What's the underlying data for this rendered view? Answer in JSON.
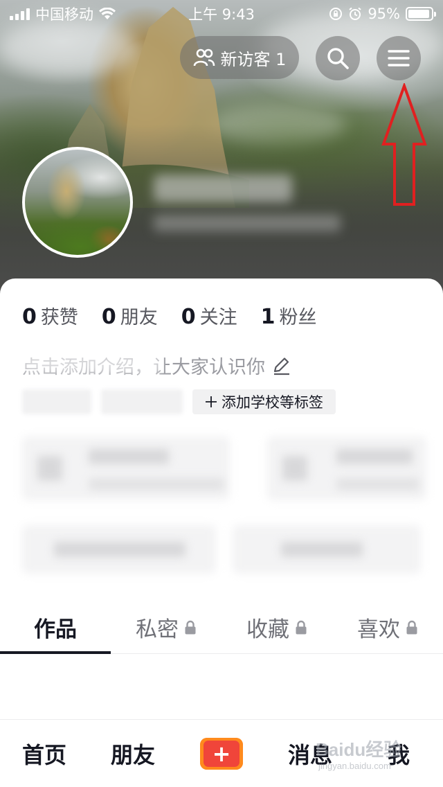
{
  "status_bar": {
    "carrier": "中国移动",
    "time": "上午 9:43",
    "battery_text": "95%",
    "battery_level": 0.95
  },
  "header": {
    "visitor_label": "新访客 1",
    "search_icon": "search-icon",
    "menu_icon": "menu-icon",
    "visitor_icon": "people-icon",
    "annotation_color": "#e02020"
  },
  "stats": [
    {
      "value": "0",
      "label": "获赞"
    },
    {
      "value": "0",
      "label": "朋友"
    },
    {
      "value": "0",
      "label": "关注"
    },
    {
      "value": "1",
      "label": "粉丝"
    }
  ],
  "profile": {
    "intro_text": "点击添加介绍，让大家认识你",
    "add_tag_label": "添加学校等标签"
  },
  "tabs": [
    {
      "label": "作品",
      "locked": false,
      "active": true
    },
    {
      "label": "私密",
      "locked": true,
      "active": false
    },
    {
      "label": "收藏",
      "locked": true,
      "active": false
    },
    {
      "label": "喜欢",
      "locked": true,
      "active": false
    }
  ],
  "bottom_nav": {
    "home": "首页",
    "friends": "朋友",
    "create": "+",
    "messages": "消息",
    "me": "我"
  },
  "watermark": {
    "logo": "Baidu经验",
    "url": "jingyan.baidu.com"
  },
  "colors": {
    "accent_orange": "#ff8a1d",
    "accent_red": "#f0453a",
    "text_primary": "#161823"
  }
}
